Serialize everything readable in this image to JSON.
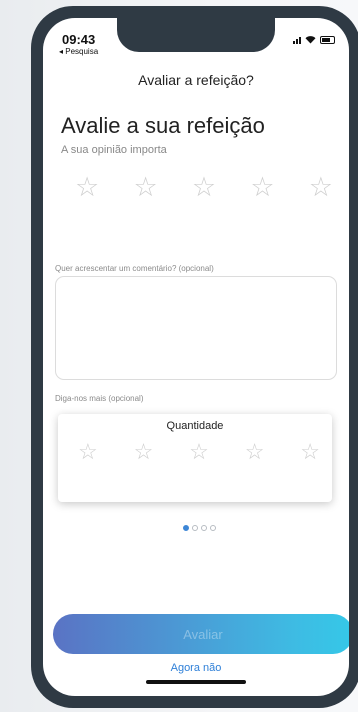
{
  "status_bar": {
    "time": "09:43",
    "back_label": "◂ Pesquisa"
  },
  "screen": {
    "title": "Avaliar a refeição?"
  },
  "rating": {
    "heading": "Avalie a sua refeição",
    "subtitle": "A sua opinião importa",
    "stars": 5,
    "value": 0
  },
  "comment": {
    "label": "Quer acrescentar um comentário? (opcional)",
    "value": ""
  },
  "more": {
    "label": "Diga-nos mais (opcional)",
    "card_title": "Quantidade",
    "stars": 5,
    "value": 0,
    "page_count": 4,
    "active_page": 1
  },
  "actions": {
    "submit_label": "Avaliar",
    "skip_label": "Agora não"
  },
  "colors": {
    "accent": "#3d86d6",
    "gradient_start": "#5a73c4",
    "gradient_end": "#35c8e8",
    "frame": "#2f3a44"
  },
  "icons": {
    "star": "star-outline-icon"
  }
}
